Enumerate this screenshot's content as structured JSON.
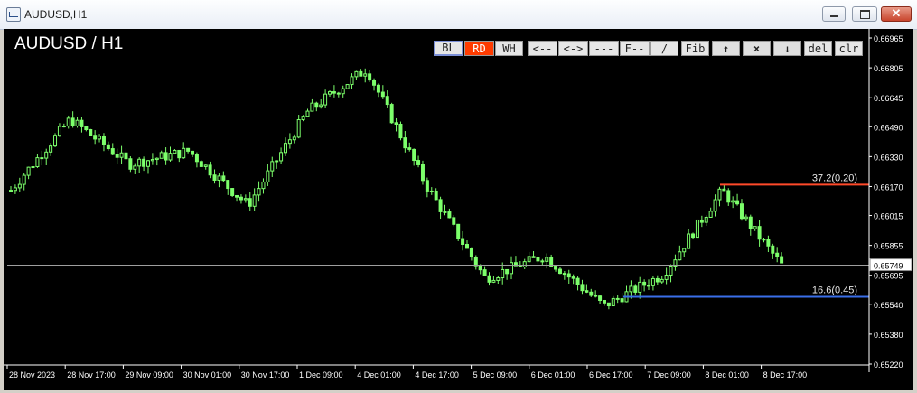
{
  "window": {
    "title": "AUDUSD,H1",
    "minimize_label": "",
    "close_symbol": "✕"
  },
  "chart": {
    "symbol_title": "AUDUSD / H1",
    "current_price": "0.65749",
    "price_ticks": [
      "0.66965",
      "0.66805",
      "0.66645",
      "0.66490",
      "0.66330",
      "0.66170",
      "0.66015",
      "0.65855",
      "0.65695",
      "0.65540",
      "0.65380",
      "0.65220"
    ],
    "time_ticks": [
      "28 Nov 2023",
      "28 Nov 17:00",
      "29 Nov 09:00",
      "30 Nov 01:00",
      "30 Nov 17:00",
      "1 Dec 09:00",
      "4 Dec 01:00",
      "4 Dec 17:00",
      "5 Dec 09:00",
      "6 Dec 01:00",
      "6 Dec 17:00",
      "7 Dec 09:00",
      "8 Dec 01:00",
      "8 Dec 17:00"
    ],
    "fib_upper_label": "37.2(0.20)",
    "fib_lower_label": "16.6(0.45)",
    "colors": {
      "candles": "#7cff6b",
      "upper_line": "#ff4a2a",
      "lower_line": "#3a6ee8",
      "price_line": "#9e9e9e"
    }
  },
  "toolbar": {
    "buttons": [
      "BL",
      "RD",
      "WH",
      "<--",
      "<->",
      "---",
      "F--",
      "/",
      "Fib",
      "↑",
      "×",
      "↓",
      "del",
      "clr"
    ]
  },
  "chart_data": {
    "type": "line",
    "title": "AUDUSD / H1",
    "x": [
      "28 Nov 2023",
      "28 Nov 17:00",
      "29 Nov 09:00",
      "30 Nov 01:00",
      "30 Nov 17:00",
      "1 Dec 09:00",
      "4 Dec 01:00",
      "4 Dec 17:00",
      "5 Dec 09:00",
      "6 Dec 01:00",
      "6 Dec 17:00",
      "7 Dec 09:00",
      "8 Dec 01:00",
      "8 Dec 17:00"
    ],
    "series": [
      {
        "values": [
          0.6615,
          0.6653,
          0.6629,
          0.6636,
          0.6607,
          0.6657,
          0.668,
          0.6618,
          0.6568,
          0.658,
          0.6553,
          0.657,
          0.6615,
          0.6575
        ]
      }
    ],
    "ylim": [
      0.6522,
      0.6697
    ],
    "annotations": [
      {
        "label": "37.2(0.20)",
        "y": 0.6618
      },
      {
        "label": "16.6(0.45)",
        "y": 0.6558
      }
    ],
    "current_price": 0.65749,
    "grid": false
  }
}
